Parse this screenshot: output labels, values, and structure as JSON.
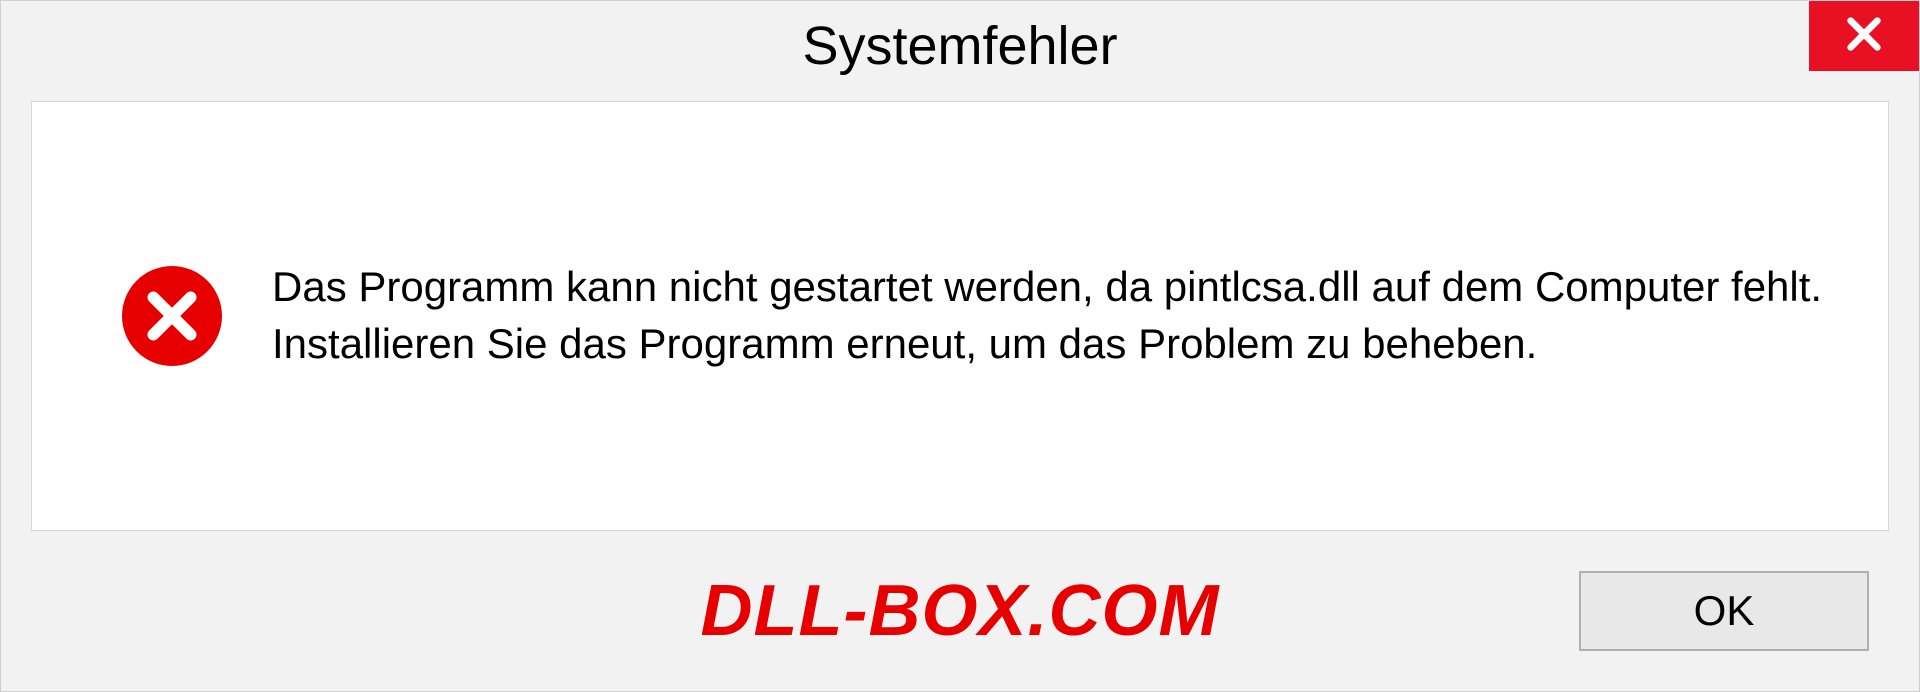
{
  "dialog": {
    "title": "Systemfehler",
    "message": "Das Programm kann nicht gestartet werden, da pintlcsa.dll auf dem Computer fehlt. Installieren Sie das Programm erneut, um das Problem zu beheben.",
    "ok_label": "OK"
  },
  "watermark": "DLL-BOX.COM",
  "colors": {
    "close_bg": "#e81123",
    "error_red": "#e60000"
  }
}
